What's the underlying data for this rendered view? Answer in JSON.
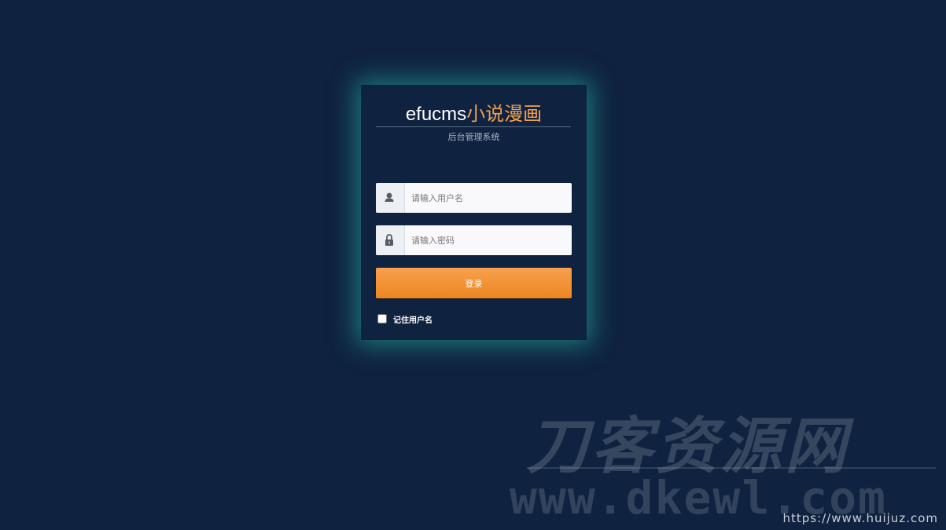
{
  "brand": {
    "title_en": "efucms",
    "title_cn": "小说漫画",
    "subtitle": "后台管理系统"
  },
  "form": {
    "username_placeholder": "请输入用户名",
    "password_placeholder": "请输入密码",
    "username_icon": "user-icon",
    "password_icon": "lock-icon",
    "login_label": "登录",
    "remember_label": "记住用户名"
  },
  "watermark": {
    "cn_text": "刀客资源网",
    "en_text": "www.dkewl.com",
    "url_text": "https://www.huijuz.com"
  },
  "colors": {
    "background": "#0f2340",
    "accent": "#f0a050",
    "button": "#ee8622",
    "glow": "#28beaa"
  }
}
